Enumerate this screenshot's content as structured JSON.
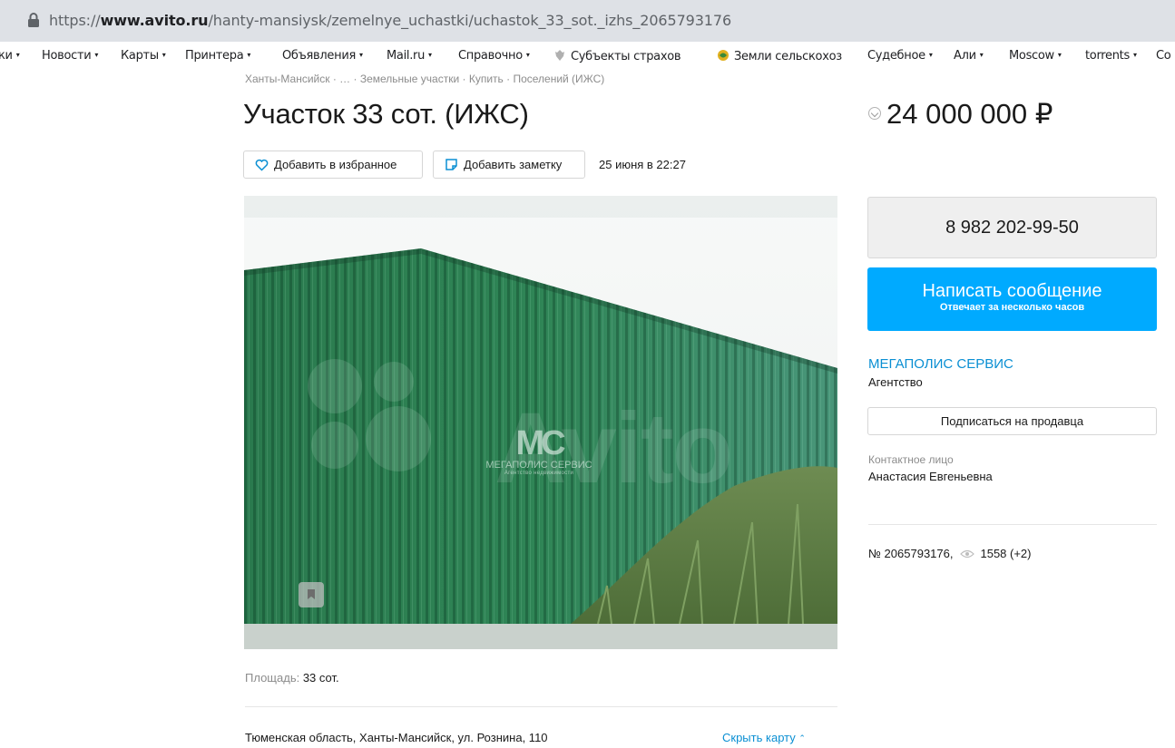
{
  "browser": {
    "url_prefix": "https://",
    "url_domain": "www.avito.ru",
    "url_path": "/hanty-mansiysk/zemelnye_uchastki/uchastok_33_sot._izhs_2065793176",
    "bookmarks": [
      {
        "label": "ки",
        "caret": "▾"
      },
      {
        "label": "Новости",
        "caret": "▾"
      },
      {
        "label": "Карты",
        "caret": "▾"
      },
      {
        "label": "Принтера",
        "caret": "▾"
      },
      {
        "label": "Объявления",
        "caret": "▾"
      },
      {
        "label": "Mail.ru",
        "caret": "▾"
      },
      {
        "label": "Справочно",
        "caret": "▾"
      },
      {
        "label": "Субъекты страхов",
        "caret": ""
      },
      {
        "label": "Земли сельскохоз",
        "caret": ""
      },
      {
        "label": "Судебное",
        "caret": "▾"
      },
      {
        "label": "Али",
        "caret": "▾"
      },
      {
        "label": "Moscow",
        "caret": "▾"
      },
      {
        "label": "torrents",
        "caret": "▾"
      },
      {
        "label": "Co",
        "caret": ""
      }
    ]
  },
  "breadcrumbs": "Ханты-Мансийск · … · Земельные участки · Купить · Поселений (ИЖС)",
  "listing": {
    "title": "Участок 33 сот. (ИЖС)",
    "price": "24 000 000 ₽",
    "add_favorite_label": "Добавить в избранное",
    "add_note_label": "Добавить заметку",
    "date": "25 июня в 22:27",
    "photo_watermark": {
      "brand": "МЕГАПОЛИС СЕРВИС",
      "tagline": "Агентство недвижимости",
      "site": "Avito"
    },
    "area_label": "Площадь:",
    "area_value": "33 сот.",
    "address": "Тюменская область, Ханты-Мансийск, ул. Рознина, 110",
    "hide_map_label": "Скрыть карту",
    "hide_map_caret": "⌃"
  },
  "seller": {
    "phone": "8 982 202-99-50",
    "message_label": "Написать сообщение",
    "message_sub": "Отвечает за несколько часов",
    "name": "МЕГАПОЛИС СЕРВИС",
    "type": "Агентство",
    "subscribe_label": "Подписаться на продавца",
    "contact_label": "Контактное лицо",
    "contact_name": "Анастасия Евгеньевна",
    "ad_number": "№ 2065793176,",
    "views": "1558 (+2)"
  },
  "colors": {
    "accent_blue": "#00aaff",
    "link_blue": "#0a8fd3",
    "fence_green": "#2e7d4f"
  }
}
